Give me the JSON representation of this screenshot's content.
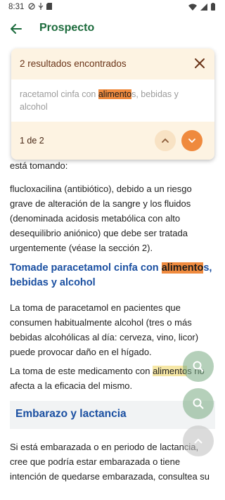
{
  "status": {
    "time": "8:31"
  },
  "appbar": {
    "title": "Prospecto"
  },
  "search_card": {
    "results_label": "2 resultados encontrados",
    "snippet_before": "racetamol cinfa con ",
    "snippet_match": "alimento",
    "snippet_after": "s, bebidas y alcohol",
    "counter": "1 de 2"
  },
  "content": {
    "line_partial": "está tomando:",
    "para_flucloxacilina": "flucloxacilina (antibiótico), debido a un riesgo grave de alteración de la sangre y los fluidos (denominada acidosis metabólica con alto desequilibrio aniónico) que debe ser tratada urgentemente (véase la sección 2).",
    "heading_before": "Tomade paracetamol cinfa con ",
    "heading_match": "alimento",
    "heading_after": "s, bebidas y alcohol",
    "para_toma": "La toma de paracetamol en pacientes que consumen habitualmente alcohol (tres o más bebidas alcohólicas al día: cerveza, vino, licor) puede provocar daño en el hígado.",
    "para_medicamento_before": "La toma de este medicamento con ",
    "para_medicamento_match": "alimento",
    "para_medicamento_after": "s no afecta a la eficacia del mismo.",
    "section_title": "Embarazo y lactancia",
    "para_embarazo": "Si está embarazada o en periodo de lactancia, cree que podría estar embarazada o tiene intención de quedarse embarazada, consultea su"
  },
  "colors": {
    "accent_green": "#1c6b3c",
    "heading_blue": "#1a4fa1",
    "match_current": "#ef8a3e",
    "match_other": "#f6e7a6"
  }
}
